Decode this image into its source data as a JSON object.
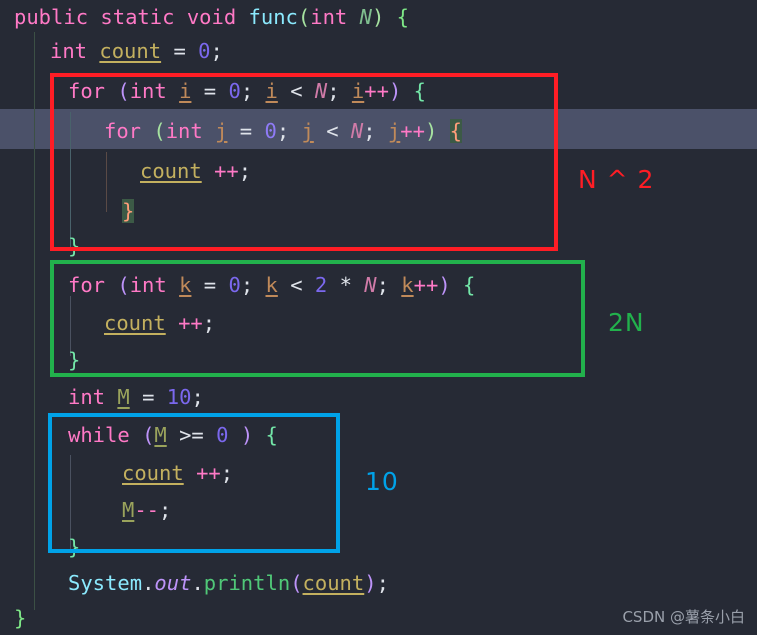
{
  "editor": {
    "theme_background": "#262a35",
    "current_line_background": "#4b5169",
    "language": "java",
    "lines": [
      {
        "id": "l1",
        "indent": 0,
        "text": "public static void func(int N) {"
      },
      {
        "id": "l2",
        "indent": 1,
        "text": "int count = 0;"
      },
      {
        "id": "l3",
        "indent": 1,
        "text": "for (int i = 0; i < N; i++) {"
      },
      {
        "id": "l4",
        "indent": 2,
        "text": "for (int j = 0; j < N; j++) {"
      },
      {
        "id": "l5",
        "indent": 3,
        "text": "count ++;"
      },
      {
        "id": "l6",
        "indent": 2,
        "text": "}"
      },
      {
        "id": "l7",
        "indent": 1,
        "text": "}"
      },
      {
        "id": "l8",
        "indent": 1,
        "text": "for (int k = 0; k < 2 * N; k++) {"
      },
      {
        "id": "l9",
        "indent": 2,
        "text": "count ++;"
      },
      {
        "id": "l10",
        "indent": 1,
        "text": "}"
      },
      {
        "id": "l11",
        "indent": 1,
        "text": "int M = 10;"
      },
      {
        "id": "l12",
        "indent": 1,
        "text": "while (M >= 0 ) {"
      },
      {
        "id": "l13",
        "indent": 2,
        "text": "count ++;"
      },
      {
        "id": "l14",
        "indent": 2,
        "text": "M--;"
      },
      {
        "id": "l15",
        "indent": 1,
        "text": "}"
      },
      {
        "id": "l16",
        "indent": 1,
        "text": "System.out.println(count);"
      },
      {
        "id": "l17",
        "indent": 0,
        "text": "}"
      }
    ],
    "highlighted_line": "l4",
    "bracket_match_open": "{",
    "bracket_match_close": "}"
  },
  "annotations": {
    "boxes": [
      {
        "id": "red-box",
        "color": "#ff1d25",
        "covers": "outer and inner for loops"
      },
      {
        "id": "green-box",
        "color": "#22b14c",
        "covers": "k loop"
      },
      {
        "id": "blue-box",
        "color": "#00a2e8",
        "covers": "while loop"
      }
    ],
    "labels": {
      "red": "N ^ 2",
      "green": "2N",
      "blue": "10"
    }
  },
  "watermark": {
    "text": "CSDN @薯条小白"
  }
}
